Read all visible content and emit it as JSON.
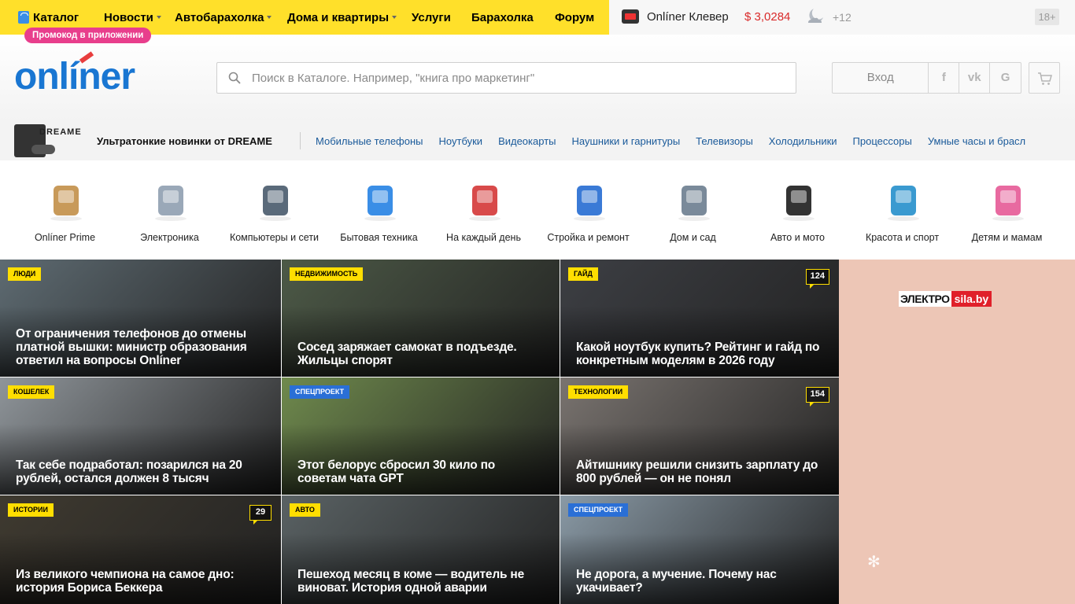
{
  "topbar": {
    "nav": [
      {
        "label": "Каталог",
        "dropdown": false
      },
      {
        "label": "Новости",
        "dropdown": true
      },
      {
        "label": "Автобарахолка",
        "dropdown": true
      },
      {
        "label": "Дома и квартиры",
        "dropdown": true
      },
      {
        "label": "Услуги",
        "dropdown": false
      },
      {
        "label": "Барахолка",
        "dropdown": false
      },
      {
        "label": "Форум",
        "dropdown": false
      }
    ],
    "promo_badge": "Промокод в приложении",
    "klever": "Onlíner Клевер",
    "rate": "$ 3,0284",
    "temperature": "+12",
    "age": "18+",
    "yellow": "#ffe02a"
  },
  "header": {
    "logo": "onlíner",
    "search_placeholder": "Поиск в Каталоге. Например, \"книга про маркетинг\"",
    "login": "Вход",
    "social": [
      "f",
      "vk",
      "G"
    ]
  },
  "linkbar": {
    "brand": "DREAME",
    "promo": "Ультратонкие новинки от DREAME",
    "links": [
      "Мобильные телефоны",
      "Ноутбуки",
      "Видеокарты",
      "Наушники и гарнитуры",
      "Телевизоры",
      "Холодильники",
      "Процессоры",
      "Умные часы и брасл"
    ]
  },
  "categories": [
    {
      "label": "Onlíner Prime",
      "icon": "box-icon"
    },
    {
      "label": "Электроника",
      "icon": "phone-icon"
    },
    {
      "label": "Компьютеры и сети",
      "icon": "laptop-icon"
    },
    {
      "label": "Бытовая техника",
      "icon": "fridge-icon"
    },
    {
      "label": "На каждый день",
      "icon": "groceries-icon"
    },
    {
      "label": "Стройка и ремонт",
      "icon": "drill-icon"
    },
    {
      "label": "Дом и сад",
      "icon": "chair-icon"
    },
    {
      "label": "Авто и мото",
      "icon": "tire-icon"
    },
    {
      "label": "Красота и спорт",
      "icon": "bicycle-icon"
    },
    {
      "label": "Детям и мамам",
      "icon": "stroller-icon"
    }
  ],
  "news": [
    {
      "tag": "Люди",
      "tag_style": "yellow",
      "comments": "",
      "title": "От ограничения телефонов до отмены платной вышки: министр образования ответил на вопросы Onlíner",
      "bg": "#5e6b72"
    },
    {
      "tag": "Недвижимость",
      "tag_style": "yellow",
      "comments": "",
      "title": "Сосед заряжает самокат в подъезде. Жильцы спорят",
      "bg": "#4d5a47"
    },
    {
      "tag": "Гайд",
      "tag_style": "yellow",
      "comments": "124",
      "title": "Какой ноутбук купить? Рейтинг и гайд по конкретным моделям в 2026 году",
      "bg": "#3d3f44"
    },
    {
      "tag": "Кошелек",
      "tag_style": "yellow",
      "comments": "",
      "title": "Так себе подработал: позарился на 20 рублей, остался должен 8 тысяч",
      "bg": "#8f959a"
    },
    {
      "tag": "Спецпроект",
      "tag_style": "blue",
      "comments": "",
      "title": "Этот белорус сбросил 30 кило по советам чата GPT",
      "bg": "#6f8a4d"
    },
    {
      "tag": "Технологии",
      "tag_style": "yellow",
      "comments": "154",
      "title": "Айтишнику решили снизить зарплату до 800 рублей — он не понял",
      "bg": "#7a7470"
    },
    {
      "tag": "Истории",
      "tag_style": "yellow",
      "comments": "29",
      "title": "Из великого чемпиона на самое дно: история Бориса Беккера",
      "bg": "#3f3a30"
    },
    {
      "tag": "Авто",
      "tag_style": "yellow",
      "comments": "",
      "title": "Пешеход месяц в коме — водитель не виноват. История одной аварии",
      "bg": "#5a6264"
    },
    {
      "tag": "Спецпроект",
      "tag_style": "blue",
      "comments": "",
      "title": "Не дорога, а мучение. Почему нас укачивает?",
      "bg": "#8a9aa6"
    }
  ],
  "ad": {
    "brand_a": "ЭЛЕКТРО",
    "brand_b": "sila.by",
    "bg": "#edc6b6"
  }
}
